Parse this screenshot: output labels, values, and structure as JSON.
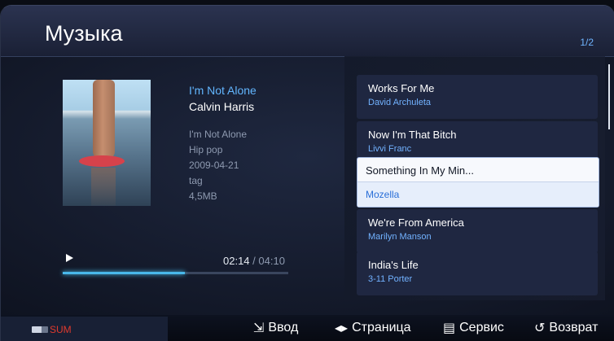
{
  "header": {
    "title": "Музыка",
    "page_indicator": "1/2"
  },
  "now_playing": {
    "title": "I'm Not Alone",
    "artist": "Calvin Harris",
    "album": "I'm Not Alone",
    "genre": "Hip pop",
    "date": "2009-04-21",
    "tag": "tag",
    "size": "4,5MB",
    "elapsed": "02:14",
    "separator": "/",
    "duration": "04:10",
    "progress_fraction": 0.54
  },
  "playlist": [
    {
      "title": "Works For Me",
      "artist": "David Archuleta"
    },
    {
      "title": "Now I'm That Bitch",
      "artist": "Livvi Franc"
    },
    {
      "title": "Something In My Min...",
      "artist": "Mozella"
    },
    {
      "title": "We're From America",
      "artist": "Marilyn Manson"
    },
    {
      "title": "India's Life",
      "artist": "3-11 Porter"
    }
  ],
  "selected_index": 2,
  "footer": {
    "sum_label": "SUM",
    "enter_label": "Ввод",
    "page_label": "Страница",
    "tools_label": "Сервис",
    "return_label": "Возврат"
  },
  "colors": {
    "accent": "#62b6ff",
    "progress": "#49b8ea",
    "sum": "#e03a2e"
  }
}
